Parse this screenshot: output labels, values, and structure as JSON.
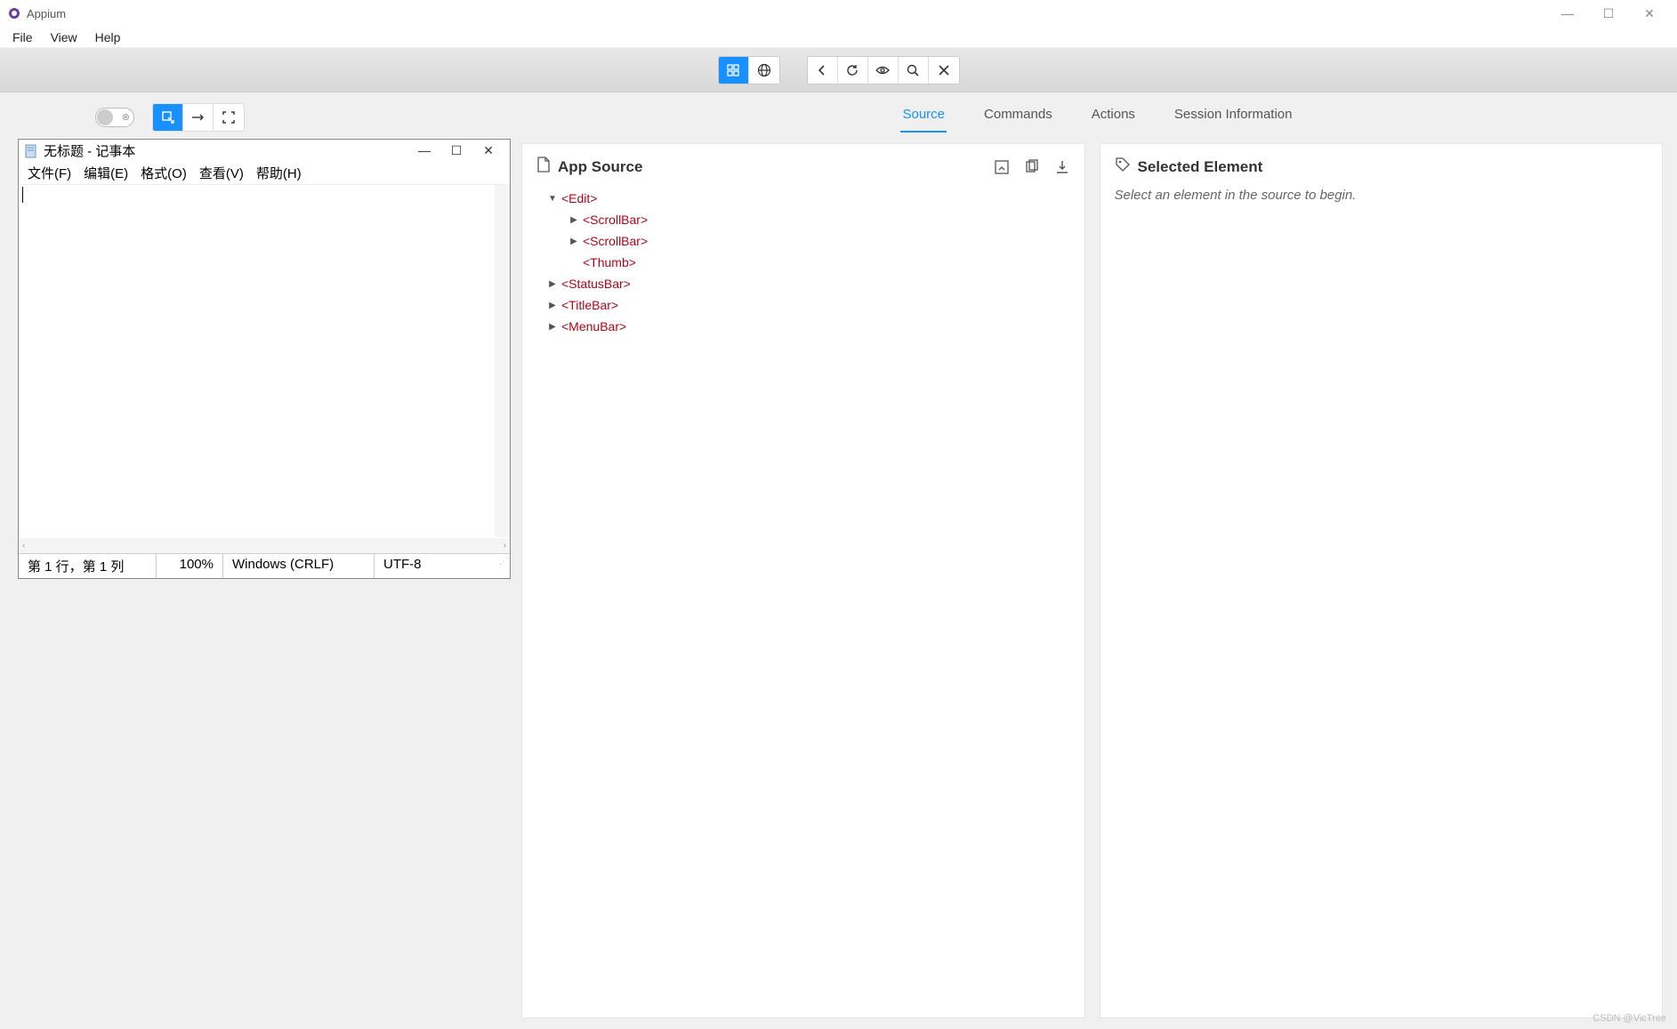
{
  "window": {
    "title": "Appium"
  },
  "menubar": {
    "items": [
      "File",
      "View",
      "Help"
    ]
  },
  "toolbar": {
    "mode_group": [
      "grid",
      "globe"
    ],
    "nav_group": [
      "back",
      "refresh",
      "eye",
      "search",
      "close"
    ]
  },
  "left_controls": {
    "select_group": [
      "select",
      "swipe",
      "fullscreen"
    ]
  },
  "preview": {
    "title": "无标题 - 记事本",
    "menu": [
      "文件(F)",
      "编辑(E)",
      "格式(O)",
      "查看(V)",
      "帮助(H)"
    ],
    "status": {
      "pos": "第 1 行，第 1 列",
      "zoom": "100%",
      "eol": "Windows (CRLF)",
      "encoding": "UTF-8"
    }
  },
  "inspector": {
    "tabs": [
      "Source",
      "Commands",
      "Actions",
      "Session Information"
    ],
    "active_tab": "Source",
    "source_panel": {
      "title": "App Source",
      "tree": [
        {
          "indent": 0,
          "arrow": "down",
          "tag": "<Edit>"
        },
        {
          "indent": 1,
          "arrow": "right",
          "tag": "<ScrollBar>"
        },
        {
          "indent": 1,
          "arrow": "right",
          "tag": "<ScrollBar>"
        },
        {
          "indent": 1,
          "arrow": "",
          "tag": "<Thumb>"
        },
        {
          "indent": 0,
          "arrow": "right",
          "tag": "<StatusBar>"
        },
        {
          "indent": 0,
          "arrow": "right",
          "tag": "<TitleBar>"
        },
        {
          "indent": 0,
          "arrow": "right",
          "tag": "<MenuBar>"
        }
      ]
    },
    "selected_panel": {
      "title": "Selected Element",
      "placeholder": "Select an element in the source to begin."
    }
  },
  "watermark": "CSDN @VicTree"
}
